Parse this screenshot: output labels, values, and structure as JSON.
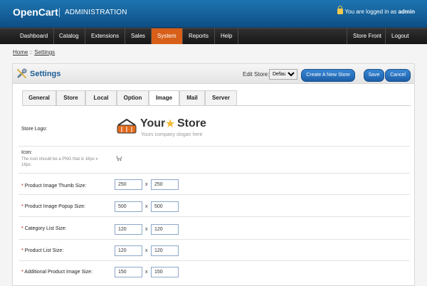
{
  "header": {
    "brand": "OpenCart",
    "section": "ADMINISTRATION",
    "login_prefix": "You are logged in as",
    "user": "admin"
  },
  "menu": [
    {
      "label": "Dashboard",
      "active": false
    },
    {
      "label": "Catalog",
      "active": false
    },
    {
      "label": "Extensions",
      "active": false
    },
    {
      "label": "Sales",
      "active": false
    },
    {
      "label": "System",
      "active": true
    },
    {
      "label": "Reports",
      "active": false
    },
    {
      "label": "Help",
      "active": false
    }
  ],
  "menu_right": [
    "Store Front",
    "Logout"
  ],
  "breadcrumb": {
    "home": "Home",
    "separator": "::",
    "current": "Settings"
  },
  "panel": {
    "title": "Settings",
    "edit_store_label": "Edit Store:",
    "store_value": "Default",
    "create_button": "Create A New Store",
    "save_button": "Save",
    "cancel_button": "Cancel",
    "tabs": [
      "General",
      "Store",
      "Local",
      "Option",
      "Image",
      "Mail",
      "Server"
    ],
    "active_tab": "Image"
  },
  "logo": {
    "your": "Your",
    "store": "Store",
    "slogan": "Yours company slogan here"
  },
  "fields": {
    "store_logo": "Store Logo:",
    "icon": "Icon:",
    "icon_hint": "The icon should be a PNG that is 16px x 16px.",
    "product_thumb": "Product Image Thumb Size:",
    "product_popup": "Product Image Popup Size:",
    "category_list": "Category List Size:",
    "product_list": "Product List Size:",
    "additional_product": "Additional Product Image Size:",
    "values": {
      "thumb": [
        "250",
        "250"
      ],
      "popup": [
        "500",
        "500"
      ],
      "category": [
        "120",
        "120"
      ],
      "product": [
        "120",
        "120"
      ],
      "additional": [
        "150",
        "150"
      ]
    },
    "separator": "x"
  },
  "colors": {
    "header": "#1d74b1",
    "menu_active": "#d85f18",
    "button": "#2d78c7"
  }
}
